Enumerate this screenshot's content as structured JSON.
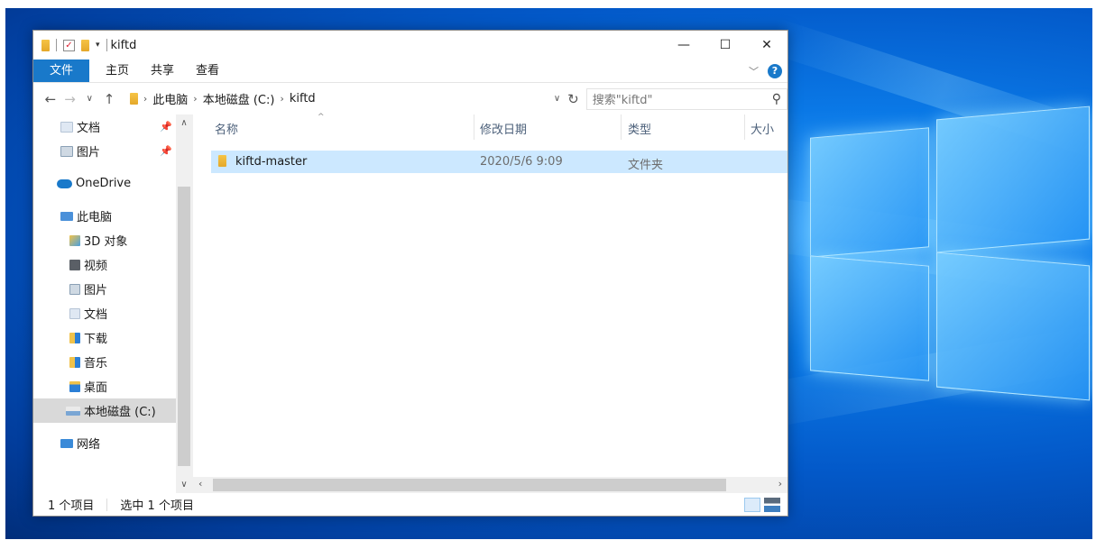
{
  "window": {
    "title": "kiftd",
    "controls": {
      "minimize": "—",
      "maximize": "☐",
      "close": "✕"
    }
  },
  "ribbon": {
    "tabs": [
      "文件",
      "主页",
      "共享",
      "查看"
    ],
    "help": "?"
  },
  "address": {
    "breadcrumbs": [
      "此电脑",
      "本地磁盘 (C:)",
      "kiftd"
    ],
    "search_placeholder": "搜索\"kiftd\""
  },
  "sidebar": {
    "items": [
      {
        "label": "文档",
        "pinned": true,
        "icon": "documents-icon"
      },
      {
        "label": "图片",
        "pinned": true,
        "icon": "pictures-icon"
      },
      {
        "label": "OneDrive",
        "icon": "onedrive-icon"
      },
      {
        "label": "此电脑",
        "icon": "this-pc-icon"
      },
      {
        "label": "3D 对象",
        "icon": "3d-objects-icon"
      },
      {
        "label": "视频",
        "icon": "videos-icon"
      },
      {
        "label": "图片",
        "icon": "pictures-icon"
      },
      {
        "label": "文档",
        "icon": "documents-icon"
      },
      {
        "label": "下载",
        "icon": "downloads-icon"
      },
      {
        "label": "音乐",
        "icon": "music-icon"
      },
      {
        "label": "桌面",
        "icon": "desktop-icon"
      },
      {
        "label": "本地磁盘 (C:)",
        "icon": "drive-icon",
        "selected": true
      },
      {
        "label": "网络",
        "icon": "network-icon"
      }
    ]
  },
  "columns": {
    "name": "名称",
    "date": "修改日期",
    "type": "类型",
    "size": "大小"
  },
  "files": [
    {
      "name": "kiftd-master",
      "date": "2020/5/6 9:09",
      "type": "文件夹",
      "selected": true
    }
  ],
  "status": {
    "count": "1 个项目",
    "selected": "选中 1 个项目"
  }
}
